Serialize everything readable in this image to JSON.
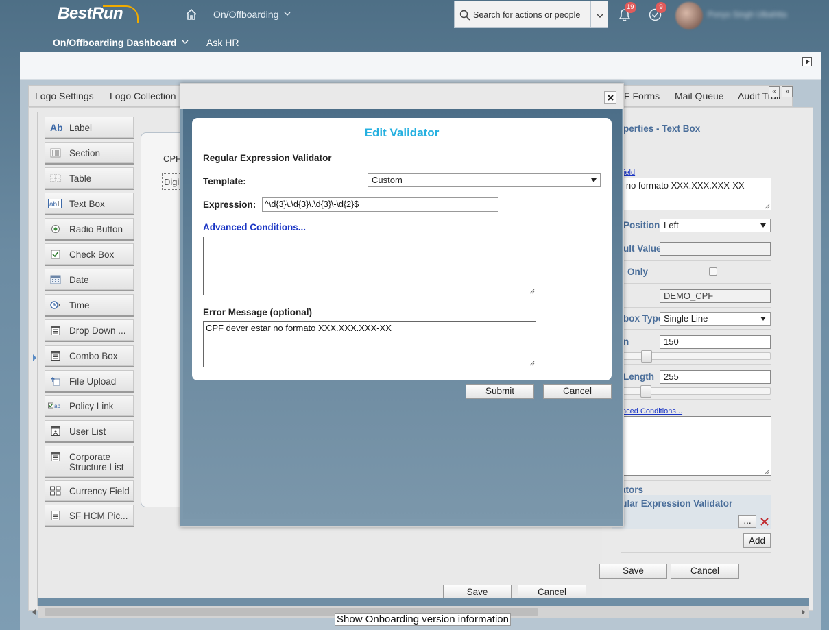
{
  "header": {
    "brand": "BestRun",
    "module": "On/Offboarding",
    "search_placeholder": "Search for actions or people",
    "notifications_count": "19",
    "tasks_count": "9",
    "user_name": "Ponys Singh Ulbahtta"
  },
  "subnav": {
    "dashboard": "On/Offboarding Dashboard",
    "askhr": "Ask HR"
  },
  "tabs": {
    "logo_settings": "Logo Settings",
    "logo_collection": "Logo Collection",
    "pdf_forms": "F Forms",
    "mail_queue": "Mail Queue",
    "audit_trail": "Audit Trail",
    "collapse": "«",
    "expand": "»"
  },
  "palette": [
    {
      "label": "Label",
      "icon": "label-icon"
    },
    {
      "label": "Section",
      "icon": "section-icon"
    },
    {
      "label": "Table",
      "icon": "table-icon"
    },
    {
      "label": "Text Box",
      "icon": "textbox-icon"
    },
    {
      "label": "Radio Button",
      "icon": "radio-icon"
    },
    {
      "label": "Check Box",
      "icon": "checkbox-icon"
    },
    {
      "label": "Date",
      "icon": "calendar-icon"
    },
    {
      "label": "Time",
      "icon": "clock-icon"
    },
    {
      "label": "Drop Down ...",
      "icon": "dropdown-icon"
    },
    {
      "label": "Combo Box",
      "icon": "combobox-icon"
    },
    {
      "label": "File Upload",
      "icon": "upload-icon"
    },
    {
      "label": "Policy Link",
      "icon": "policy-link-icon"
    },
    {
      "label": "User List",
      "icon": "user-list-icon"
    },
    {
      "label": "Corporate Structure List",
      "icon": "corporate-structure-icon"
    },
    {
      "label": "Currency Field",
      "icon": "currency-icon"
    },
    {
      "label": "SF HCM Pic...",
      "icon": "sf-hcm-icon"
    }
  ],
  "canvas": {
    "field_label": "CPF",
    "field_placeholder": "Digi"
  },
  "properties": {
    "title": "perties - Text Box",
    "field_link": "ield",
    "field_text": "e no formato XXX.XXX.XXX-XX",
    "position_label": "Position",
    "position_value": "Left",
    "default_value_label": "ult Value",
    "default_value": "",
    "read_only_label": "Only",
    "read_only_checked": false,
    "field_id_value": "DEMO_CPF",
    "textbox_type_label": "box Type",
    "textbox_type_value": "Single Line",
    "width_label": "n",
    "width_value": "150",
    "max_length_label": "Length",
    "max_length_value": "255",
    "advanced_link": "nced Conditions...",
    "validators_label": "ators",
    "validator_item": "gular Expression Validator",
    "edit_button": "...",
    "add_button": "Add",
    "save_button": "Save",
    "cancel_button": "Cancel"
  },
  "builder": {
    "save_button": "Save",
    "cancel_button": "Cancel"
  },
  "footer": {
    "version_info": "Show Onboarding version information"
  },
  "dialog": {
    "title": "Edit Validator",
    "subtitle": "Regular Expression Validator",
    "template_label": "Template:",
    "template_value": "Custom",
    "expression_label": "Expression:",
    "expression_value": "^\\d{3}\\.\\d{3}\\.\\d{3}\\-\\d{2}$",
    "advanced_link": "Advanced Conditions...",
    "advanced_value": "",
    "error_label": "Error Message (optional)",
    "error_value": "CPF dever estar no formato XXX.XXX.XXX-XX",
    "submit_button": "Submit",
    "cancel_button": "Cancel"
  },
  "colors": {
    "accent": "#25b0e0",
    "link": "#1a35c4",
    "property_label": "#4a6e9a",
    "delete": "#c0282d",
    "badge": "#e05b5b"
  }
}
